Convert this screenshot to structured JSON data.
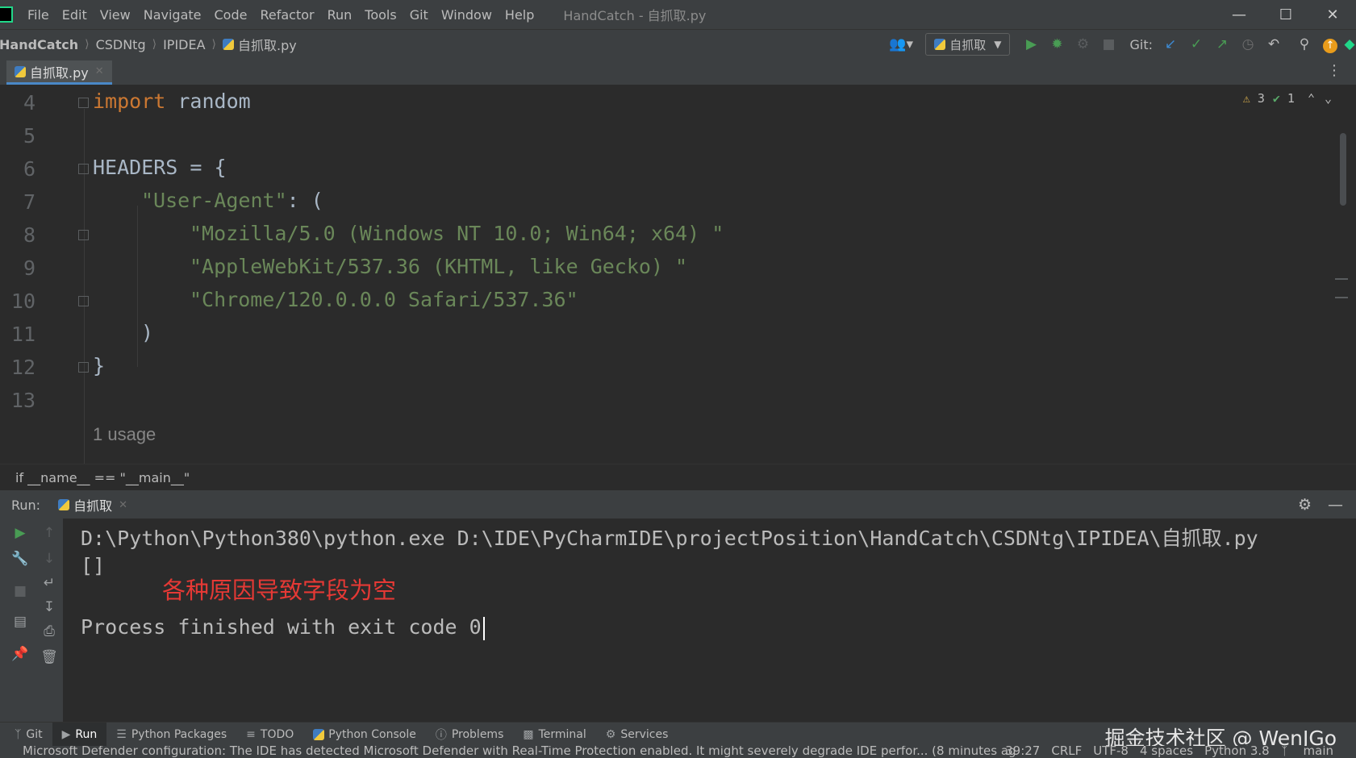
{
  "menubar": {
    "items": [
      "File",
      "Edit",
      "View",
      "Navigate",
      "Code",
      "Refactor",
      "Run",
      "Tools",
      "Git",
      "Window",
      "Help"
    ],
    "window_title": "HandCatch - 自抓取.py"
  },
  "navbar": {
    "breadcrumbs": [
      "HandCatch",
      "CSDNtg",
      "IPIDEA",
      "自抓取.py"
    ],
    "run_config": "自抓取",
    "git_label": "Git:"
  },
  "editor_tab": {
    "label": "自抓取.py"
  },
  "inspections": {
    "warnings": "3",
    "ok": "1"
  },
  "code": {
    "line_numbers": [
      "4",
      "5",
      "6",
      "7",
      "8",
      "9",
      "10",
      "11",
      "12",
      "13"
    ],
    "line4": {
      "kw": "import",
      "rest": " random"
    },
    "line6": "HEADERS = {",
    "line7": {
      "str": "\"User-Agent\"",
      "rest": ": ("
    },
    "line8": "\"Mozilla/5.0 (Windows NT 10.0; Win64; x64) \"",
    "line9": "\"AppleWebKit/537.36 (KHTML, like Gecko) \"",
    "line10": "\"Chrome/120.0.0.0 Safari/537.36\"",
    "line11": ")",
    "line12": "}",
    "usage_hint": "1 usage"
  },
  "breadcrumb_bar": "if __name__ == \"__main__\"",
  "run_panel": {
    "label": "Run:",
    "tab": "自抓取",
    "console": {
      "command": "D:\\Python\\Python380\\python.exe D:\\IDE\\PyCharmIDE\\projectPosition\\HandCatch\\CSDNtg\\IPIDEA\\自抓取.py",
      "output": "[]",
      "annotation": "各种原因导致字段为空",
      "exit": "Process finished with exit code 0"
    }
  },
  "tool_windows": [
    "Git",
    "Run",
    "Python Packages",
    "TODO",
    "Python Console",
    "Problems",
    "Terminal",
    "Services"
  ],
  "watermark": "掘金技术社区 @ WenJGo",
  "statusbar": {
    "message": "Microsoft Defender configuration: The IDE has detected Microsoft Defender with Real-Time Protection enabled. It might severely degrade IDE perfor... (8 minutes ag",
    "position": "39:27",
    "line_sep": "CRLF",
    "encoding": "UTF-8",
    "indent": "4 spaces",
    "interpreter": "Python 3.8",
    "branch": "main"
  },
  "colors": {
    "keyword": "#cc7832",
    "string": "#6a8759",
    "annotation": "#e53935",
    "run_green": "#499c54",
    "tab_underline": "#4a88c7"
  }
}
